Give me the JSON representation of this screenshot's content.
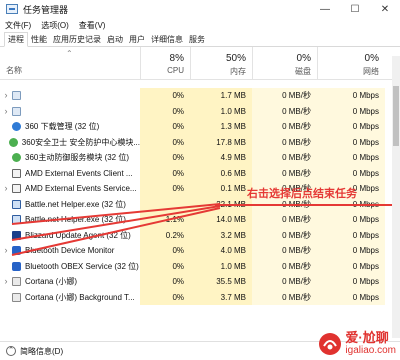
{
  "window": {
    "title": "任务管理器",
    "controls": {
      "minimize": "—",
      "maximize": "☐",
      "close": "✕"
    }
  },
  "menu": [
    "文件(F)",
    "选项(O)",
    "查看(V)"
  ],
  "tabs": [
    "进程",
    "性能",
    "应用历史记录",
    "启动",
    "用户",
    "详细信息",
    "服务"
  ],
  "active_tab": 0,
  "table": {
    "sort_arrow": "⌃",
    "name_header": "名称",
    "columns": [
      {
        "pct": "8%",
        "label": "CPU"
      },
      {
        "pct": "50%",
        "label": "内存"
      },
      {
        "pct": "0%",
        "label": "磁盘"
      },
      {
        "pct": "0%",
        "label": "网络"
      }
    ],
    "rows": [
      {
        "expand": "›",
        "icon": "generic-app-icon",
        "name": "",
        "cpu": "0%",
        "mem": "1.7 MB",
        "disk": "0 MB/秒",
        "net": "0 Mbps"
      },
      {
        "expand": "›",
        "icon": "generic-app-icon",
        "name": "",
        "cpu": "0%",
        "mem": "1.0 MB",
        "disk": "0 MB/秒",
        "net": "0 Mbps"
      },
      {
        "expand": "",
        "icon": "360-download-icon",
        "name": "360 下载管理 (32 位)",
        "cpu": "0%",
        "mem": "1.3 MB",
        "disk": "0 MB/秒",
        "net": "0 Mbps"
      },
      {
        "expand": "",
        "icon": "360-safe-icon",
        "name": "360安全卫士 安全防护中心模块...",
        "cpu": "0%",
        "mem": "17.8 MB",
        "disk": "0 MB/秒",
        "net": "0 Mbps"
      },
      {
        "expand": "",
        "icon": "360-safe-icon",
        "name": "360主动防御服务模块 (32 位)",
        "cpu": "0%",
        "mem": "4.9 MB",
        "disk": "0 MB/秒",
        "net": "0 Mbps"
      },
      {
        "expand": "",
        "icon": "amd-app-icon",
        "name": "AMD External Events Client ...",
        "cpu": "0%",
        "mem": "0.6 MB",
        "disk": "0 MB/秒",
        "net": "0 Mbps"
      },
      {
        "expand": "›",
        "icon": "amd-app-icon",
        "name": "AMD External Events Service...",
        "cpu": "0%",
        "mem": "0.1 MB",
        "disk": "0 MB/秒",
        "net": "0 Mbps"
      },
      {
        "expand": "",
        "icon": "battlenet-icon",
        "name": "Battle.net Helper.exe (32 位)",
        "cpu": "",
        "mem": "22.1 MB",
        "disk": "0 MB/秒",
        "net": "0 Mbps"
      },
      {
        "expand": "",
        "icon": "battlenet-icon",
        "name": "Battle.net Helper.exe (32 位)",
        "cpu": "1.1%",
        "mem": "14.0 MB",
        "disk": "0 MB/秒",
        "net": "0 Mbps"
      },
      {
        "expand": "",
        "icon": "blizzard-icon",
        "name": "Blizzard Update Agent (32 位)",
        "cpu": "0.2%",
        "mem": "3.2 MB",
        "disk": "0 MB/秒",
        "net": "0 Mbps"
      },
      {
        "expand": "›",
        "icon": "bluetooth-icon",
        "name": "Bluetooth Device Monitor",
        "cpu": "0%",
        "mem": "4.0 MB",
        "disk": "0 MB/秒",
        "net": "0 Mbps"
      },
      {
        "expand": "",
        "icon": "bluetooth-icon",
        "name": "Bluetooth OBEX Service (32 位)",
        "cpu": "0%",
        "mem": "1.0 MB",
        "disk": "0 MB/秒",
        "net": "0 Mbps"
      },
      {
        "expand": "›",
        "icon": "cortana-icon",
        "name": "Cortana (小娜)",
        "cpu": "0%",
        "mem": "35.5 MB",
        "disk": "0 MB/秒",
        "net": "0 Mbps"
      },
      {
        "expand": "",
        "icon": "cortana-icon",
        "name": "Cortana (小娜) Background T...",
        "cpu": "0%",
        "mem": "3.7 MB",
        "disk": "0 MB/秒",
        "net": "0 Mbps"
      }
    ]
  },
  "annotation": {
    "text": "右击选择后点结束任务",
    "color": "#e53935"
  },
  "footer": {
    "icon": "collapse-icon",
    "label": "简略信息(D)"
  },
  "watermark": {
    "title": "爱·尬聊",
    "url": "igaliao.com",
    "color": "#e0322f"
  }
}
